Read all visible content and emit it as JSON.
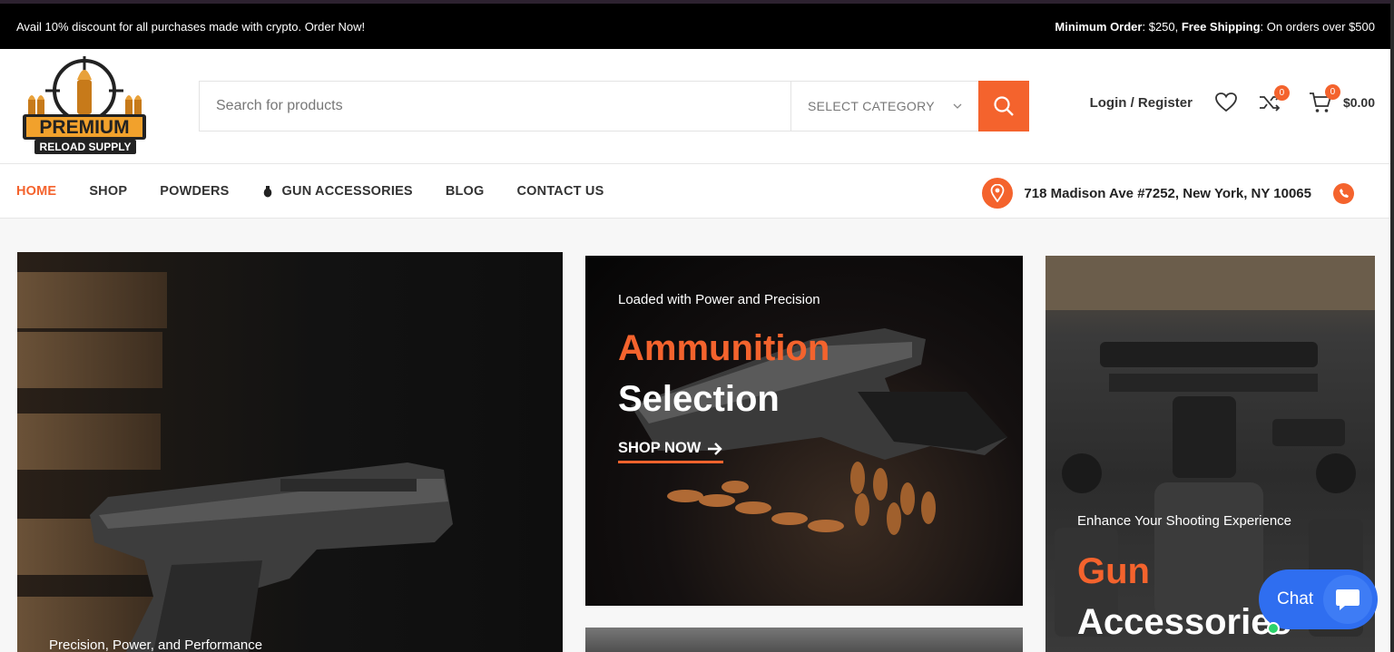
{
  "topbar": {
    "promo": "Avail 10% discount for all purchases made with crypto. Order Now!",
    "min_order_label": "Minimum Order",
    "min_order_value": ": $250, ",
    "free_shipping_label": "Free Shipping",
    "free_shipping_value": ": On orders over $500"
  },
  "logo": {
    "line1": "PREMIUM",
    "line2": "RELOAD SUPPLY"
  },
  "search": {
    "placeholder": "Search for products",
    "category": "SELECT CATEGORY"
  },
  "header": {
    "login": "Login / Register",
    "compare_count": "0",
    "cart_count": "0",
    "cart_total": "$0.00"
  },
  "nav": {
    "items": [
      {
        "label": "HOME",
        "active": true
      },
      {
        "label": "SHOP"
      },
      {
        "label": "POWDERS"
      },
      {
        "label": "GUN ACCESSORIES"
      },
      {
        "label": "BLOG"
      },
      {
        "label": "CONTACT US"
      }
    ],
    "address": "718 Madison Ave #7252, New York, NY 10065"
  },
  "banners": {
    "left": {
      "subtitle": "Precision, Power, and Performance"
    },
    "middle": {
      "subtitle": "Loaded with Power and Precision",
      "title1": "Ammunition",
      "title2": "Selection",
      "cta": "SHOP NOW"
    },
    "right": {
      "subtitle": "Enhance Your Shooting Experience",
      "title1": "Gun",
      "title2": "Accessories"
    }
  },
  "chat": {
    "label": "Chat"
  },
  "colors": {
    "accent": "#f4632d",
    "topbar": "#000000",
    "chat": "#2f6ef0"
  }
}
